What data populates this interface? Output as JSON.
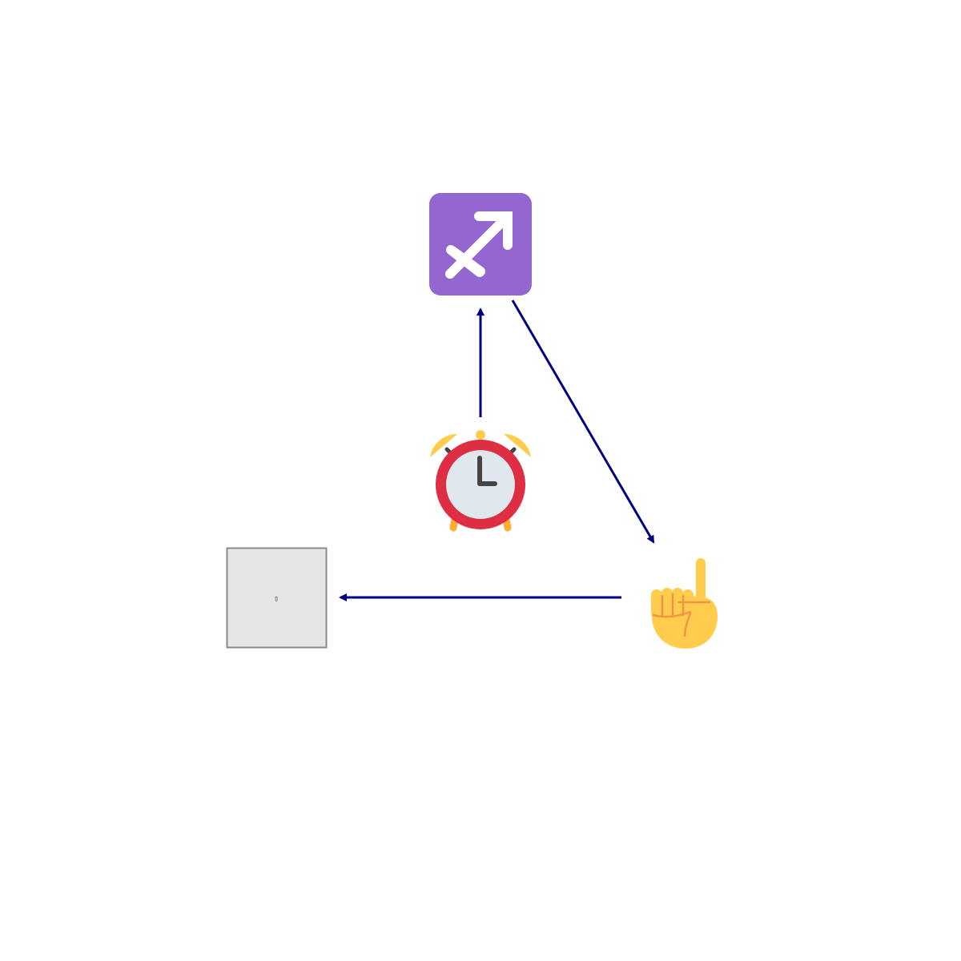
{
  "diagram": {
    "nodes": [
      {
        "id": "sagittarius",
        "icon": "sagittarius-icon",
        "color": "#9466cf"
      },
      {
        "id": "alarm-clock",
        "icon": "alarm-clock-icon",
        "color": "#dd2e44"
      },
      {
        "id": "pointing-hand",
        "icon": "index-pointing-up-icon",
        "color": "#ffdc5d"
      },
      {
        "id": "missing-image",
        "icon": "missing-glyph-icon",
        "color": "#e6e6e6",
        "glyph": "▯"
      }
    ],
    "edges": [
      {
        "from": "alarm-clock",
        "to": "sagittarius"
      },
      {
        "from": "sagittarius",
        "to": "pointing-hand"
      },
      {
        "from": "pointing-hand",
        "to": "missing-image"
      }
    ],
    "edge_color": "#000080"
  }
}
